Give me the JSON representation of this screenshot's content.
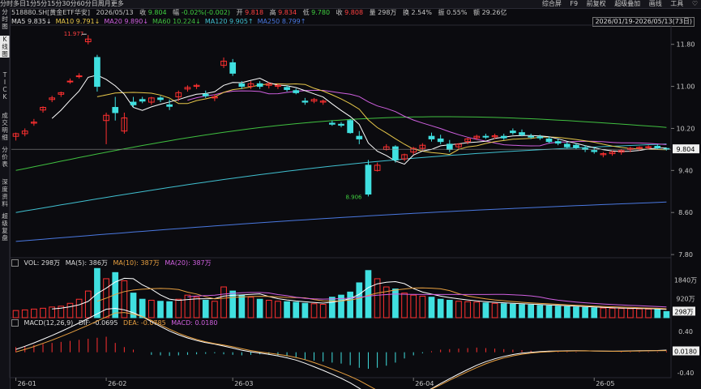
{
  "timeframes": [
    {
      "label": "分时",
      "active": false
    },
    {
      "label": "多日",
      "active": false
    },
    {
      "label": "1分",
      "active": false
    },
    {
      "label": "5分",
      "active": false
    },
    {
      "label": "15分",
      "active": false
    },
    {
      "label": "30分",
      "active": false
    },
    {
      "label": "60分",
      "active": false
    },
    {
      "label": "日",
      "active": true
    },
    {
      "label": "周",
      "active": false
    },
    {
      "label": "月",
      "active": false
    },
    {
      "label": "更多",
      "active": false
    }
  ],
  "toolbar": {
    "composite": "综合屏",
    "f9": "F9",
    "prev_restore": "前复权",
    "overlay": "超级叠加",
    "draw": "画线",
    "tools": "工具",
    "fav_icon": "heart-icon"
  },
  "sidebar": [
    {
      "label": "分时图",
      "active": false
    },
    {
      "label": "K线图",
      "active": true
    },
    {
      "label": "TICK",
      "active": false
    },
    {
      "label": "成交明细",
      "active": false
    },
    {
      "label": "分价表",
      "active": false
    },
    {
      "label": "深度资料",
      "active": false
    },
    {
      "label": "超级复盘",
      "active": false
    }
  ],
  "info": {
    "code_name": "518880.SH[黄金ETF华安]",
    "date": "2026/05/13",
    "close_label": "收",
    "close": "9.804",
    "change_label": "幅",
    "change": "-0.02%(-0.002)",
    "open_label": "开",
    "open": "9.818",
    "high_label": "高",
    "high": "9.834",
    "low_label": "低",
    "low": "9.780",
    "last_label": "收",
    "last": "9.808",
    "vol_label": "量",
    "vol": "298万",
    "turnover_label": "换",
    "turnover": "2.54%",
    "amp_label": "振",
    "amp": "0.55%",
    "amount_label": "额",
    "amount": "29.26亿"
  },
  "ma": [
    {
      "label": "MA5",
      "value": "9.835",
      "arrow": "↓",
      "color": "#ffffff"
    },
    {
      "label": "MA10",
      "value": "9.791",
      "arrow": "↓",
      "color": "#e8c84a"
    },
    {
      "label": "MA20",
      "value": "9.890",
      "arrow": "↓",
      "color": "#d060e0"
    },
    {
      "label": "MA60",
      "value": "10.224",
      "arrow": "↓",
      "color": "#40c040"
    },
    {
      "label": "MA120",
      "value": "9.905",
      "arrow": "↑",
      "color": "#40c0d0"
    },
    {
      "label": "MA250",
      "value": "8.799",
      "arrow": "↑",
      "color": "#4a78e0"
    }
  ],
  "date_range": "2026/01/19-2026/05/13(73日)",
  "vol_legend": {
    "vol": "VOL: 298万",
    "ma5": "MA(5): 386万",
    "ma10": "MA(10): 387万",
    "ma20": "MA(20): 387万"
  },
  "macd_legend": {
    "title": "MACD(12,26,9)",
    "dif": "DIF: -0.0695",
    "dea": "DEA: -0.0785",
    "macd": "MACD: 0.0180"
  },
  "annotations": {
    "high_mark": "11.977",
    "low_mark": "8.906",
    "current_price": "9.804",
    "vol_current": "298万",
    "macd_current": "0.0180"
  },
  "chart_data": {
    "type": "candlestick",
    "price_ticks": [
      "11.80",
      "11.00",
      "10.20",
      "9.40",
      "8.60",
      "7.80"
    ],
    "price_tick_values": [
      11.8,
      11.0,
      10.2,
      9.4,
      8.6,
      7.8
    ],
    "price_range": [
      7.74,
      12.15
    ],
    "vol_ticks": [
      "1840万",
      "920万"
    ],
    "vol_tick_values": [
      1840,
      920
    ],
    "vol_max": 2450,
    "macd_ticks": [
      "0.40",
      "-0.40"
    ],
    "macd_tick_values": [
      0.4,
      -0.4
    ],
    "macd_range": [
      -0.46,
      0.48
    ],
    "x_labels": [
      {
        "label": "26-01",
        "index": 0
      },
      {
        "label": "26-02",
        "index": 10
      },
      {
        "label": "26-03",
        "index": 24
      },
      {
        "label": "26-04",
        "index": 44
      },
      {
        "label": "26-05",
        "index": 64
      }
    ],
    "candles": [
      {
        "o": 10.05,
        "h": 10.12,
        "l": 9.97,
        "c": 10.1
      },
      {
        "o": 10.1,
        "h": 10.2,
        "l": 10.05,
        "c": 10.15
      },
      {
        "o": 10.3,
        "h": 10.38,
        "l": 10.25,
        "c": 10.32
      },
      {
        "o": 10.55,
        "h": 10.62,
        "l": 10.5,
        "c": 10.6
      },
      {
        "o": 10.75,
        "h": 10.82,
        "l": 10.7,
        "c": 10.78
      },
      {
        "o": 10.85,
        "h": 10.9,
        "l": 10.8,
        "c": 10.88
      },
      {
        "o": 11.1,
        "h": 11.15,
        "l": 11.05,
        "c": 11.1
      },
      {
        "o": 11.2,
        "h": 11.25,
        "l": 11.15,
        "c": 11.2
      },
      {
        "o": 11.85,
        "h": 11.977,
        "l": 11.8,
        "c": 11.9
      },
      {
        "o": 11.55,
        "h": 11.6,
        "l": 10.9,
        "c": 11.0
      },
      {
        "o": 10.35,
        "h": 10.5,
        "l": 9.9,
        "c": 10.45
      },
      {
        "o": 10.6,
        "h": 10.8,
        "l": 10.35,
        "c": 10.5
      },
      {
        "o": 10.15,
        "h": 10.5,
        "l": 10.1,
        "c": 10.4
      },
      {
        "o": 10.7,
        "h": 10.8,
        "l": 10.6,
        "c": 10.65
      },
      {
        "o": 10.75,
        "h": 10.8,
        "l": 10.68,
        "c": 10.72
      },
      {
        "o": 10.7,
        "h": 10.8,
        "l": 10.65,
        "c": 10.78
      },
      {
        "o": 10.78,
        "h": 10.82,
        "l": 10.7,
        "c": 10.75
      },
      {
        "o": 10.65,
        "h": 10.75,
        "l": 10.55,
        "c": 10.62
      },
      {
        "o": 10.8,
        "h": 10.92,
        "l": 10.72,
        "c": 10.88
      },
      {
        "o": 10.95,
        "h": 11.02,
        "l": 10.9,
        "c": 10.98
      },
      {
        "o": 11.0,
        "h": 11.05,
        "l": 10.95,
        "c": 11.02
      },
      {
        "o": 10.85,
        "h": 10.92,
        "l": 10.78,
        "c": 10.82
      },
      {
        "o": 10.78,
        "h": 10.85,
        "l": 10.72,
        "c": 10.8
      },
      {
        "o": 11.4,
        "h": 11.55,
        "l": 11.35,
        "c": 11.48
      },
      {
        "o": 11.45,
        "h": 11.52,
        "l": 11.2,
        "c": 11.25
      },
      {
        "o": 11.05,
        "h": 11.1,
        "l": 10.95,
        "c": 11.0
      },
      {
        "o": 11.0,
        "h": 11.1,
        "l": 10.95,
        "c": 11.05
      },
      {
        "o": 11.05,
        "h": 11.1,
        "l": 10.95,
        "c": 11.0
      },
      {
        "o": 11.02,
        "h": 11.08,
        "l": 10.96,
        "c": 11.05
      },
      {
        "o": 11.0,
        "h": 11.05,
        "l": 10.95,
        "c": 11.02
      },
      {
        "o": 10.98,
        "h": 11.02,
        "l": 10.9,
        "c": 10.94
      },
      {
        "o": 10.92,
        "h": 10.96,
        "l": 10.85,
        "c": 10.88
      },
      {
        "o": 10.72,
        "h": 10.78,
        "l": 10.65,
        "c": 10.7
      },
      {
        "o": 10.72,
        "h": 10.78,
        "l": 10.68,
        "c": 10.75
      },
      {
        "o": 10.7,
        "h": 10.75,
        "l": 10.65,
        "c": 10.72
      },
      {
        "o": 10.3,
        "h": 10.35,
        "l": 10.25,
        "c": 10.28
      },
      {
        "o": 10.28,
        "h": 10.32,
        "l": 10.22,
        "c": 10.26
      },
      {
        "o": 10.35,
        "h": 10.38,
        "l": 10.1,
        "c": 10.12
      },
      {
        "o": 10.05,
        "h": 10.15,
        "l": 9.9,
        "c": 10.0
      },
      {
        "o": 9.5,
        "h": 9.6,
        "l": 8.906,
        "c": 8.95
      },
      {
        "o": 9.4,
        "h": 9.55,
        "l": 9.38,
        "c": 9.5
      },
      {
        "o": 9.8,
        "h": 9.9,
        "l": 9.78,
        "c": 9.85
      },
      {
        "o": 9.85,
        "h": 9.88,
        "l": 9.55,
        "c": 9.6
      },
      {
        "o": 9.62,
        "h": 9.72,
        "l": 9.58,
        "c": 9.7
      },
      {
        "o": 9.75,
        "h": 9.85,
        "l": 9.7,
        "c": 9.82
      },
      {
        "o": 9.82,
        "h": 9.92,
        "l": 9.78,
        "c": 9.88
      },
      {
        "o": 10.05,
        "h": 10.12,
        "l": 9.95,
        "c": 10.0
      },
      {
        "o": 10.0,
        "h": 10.08,
        "l": 9.9,
        "c": 9.95
      },
      {
        "o": 9.9,
        "h": 9.98,
        "l": 9.75,
        "c": 9.8
      },
      {
        "o": 9.85,
        "h": 9.92,
        "l": 9.8,
        "c": 9.9
      },
      {
        "o": 9.95,
        "h": 10.02,
        "l": 9.9,
        "c": 10.0
      },
      {
        "o": 10.02,
        "h": 10.08,
        "l": 9.98,
        "c": 10.05
      },
      {
        "o": 10.05,
        "h": 10.1,
        "l": 10.0,
        "c": 10.04
      },
      {
        "o": 10.04,
        "h": 10.1,
        "l": 10.0,
        "c": 10.06
      },
      {
        "o": 10.05,
        "h": 10.1,
        "l": 9.98,
        "c": 10.02
      },
      {
        "o": 10.15,
        "h": 10.2,
        "l": 10.08,
        "c": 10.12
      },
      {
        "o": 10.12,
        "h": 10.18,
        "l": 10.05,
        "c": 10.08
      },
      {
        "o": 10.05,
        "h": 10.1,
        "l": 10.0,
        "c": 10.04
      },
      {
        "o": 10.04,
        "h": 10.08,
        "l": 9.98,
        "c": 10.02
      },
      {
        "o": 10.0,
        "h": 10.05,
        "l": 9.92,
        "c": 9.95
      },
      {
        "o": 9.95,
        "h": 10.0,
        "l": 9.88,
        "c": 9.92
      },
      {
        "o": 9.9,
        "h": 9.95,
        "l": 9.82,
        "c": 9.85
      },
      {
        "o": 9.88,
        "h": 9.92,
        "l": 9.8,
        "c": 9.84
      },
      {
        "o": 9.82,
        "h": 9.88,
        "l": 9.75,
        "c": 9.8
      },
      {
        "o": 9.78,
        "h": 9.85,
        "l": 9.72,
        "c": 9.76
      },
      {
        "o": 9.7,
        "h": 9.75,
        "l": 9.65,
        "c": 9.72
      },
      {
        "o": 9.72,
        "h": 9.78,
        "l": 9.68,
        "c": 9.75
      },
      {
        "o": 9.75,
        "h": 9.8,
        "l": 9.7,
        "c": 9.78
      },
      {
        "o": 9.8,
        "h": 9.85,
        "l": 9.75,
        "c": 9.82
      },
      {
        "o": 9.82,
        "h": 9.86,
        "l": 9.78,
        "c": 9.84
      },
      {
        "o": 9.84,
        "h": 9.88,
        "l": 9.8,
        "c": 9.85
      },
      {
        "o": 9.86,
        "h": 9.9,
        "l": 9.8,
        "c": 9.83
      },
      {
        "o": 9.818,
        "h": 9.834,
        "l": 9.78,
        "c": 9.804
      }
    ],
    "volume": [
      350,
      380,
      420,
      460,
      520,
      560,
      700,
      900,
      1300,
      2400,
      1900,
      2200,
      1800,
      1200,
      900,
      850,
      800,
      780,
      900,
      1100,
      1000,
      850,
      800,
      1500,
      1300,
      1100,
      1000,
      900,
      850,
      800,
      780,
      750,
      700,
      680,
      650,
      1000,
      1100,
      1250,
      1700,
      2300,
      1900,
      1500,
      1400,
      1200,
      1100,
      1050,
      1000,
      900,
      850,
      800,
      780,
      760,
      720,
      700,
      680,
      660,
      640,
      620,
      600,
      580,
      560,
      540,
      520,
      500,
      480,
      470,
      460,
      450,
      440,
      430,
      420,
      410,
      298
    ],
    "macd_hist": [
      0.1,
      0.12,
      0.14,
      0.16,
      0.18,
      0.2,
      0.22,
      0.24,
      0.26,
      0.28,
      0.3,
      0.18,
      0.1,
      0.05,
      0.0,
      -0.05,
      -0.06,
      -0.07,
      -0.06,
      -0.05,
      -0.04,
      -0.03,
      -0.02,
      -0.04,
      -0.05,
      -0.06,
      -0.05,
      -0.04,
      -0.05,
      -0.06,
      -0.08,
      -0.1,
      -0.14,
      -0.16,
      -0.18,
      -0.2,
      -0.22,
      -0.25,
      -0.3,
      -0.32,
      -0.3,
      -0.26,
      -0.2,
      -0.12,
      -0.06,
      -0.02,
      0.02,
      0.05,
      0.06,
      0.07,
      0.08,
      0.09,
      0.08,
      0.07,
      0.06,
      0.05,
      0.04,
      0.03,
      0.02,
      0.02,
      0.01,
      0.01,
      0.01,
      0.0,
      0.0,
      0.0,
      0.0,
      0.01,
      0.01,
      0.01,
      0.01,
      0.01,
      0.018
    ]
  }
}
